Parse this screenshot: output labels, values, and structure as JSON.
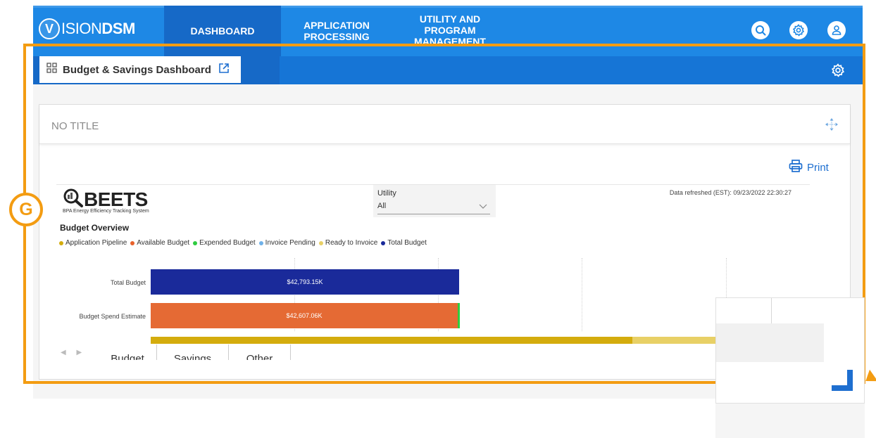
{
  "nav": {
    "logo_v": "V",
    "logo_text_a": "ISION",
    "logo_text_b": "DSM",
    "items": [
      {
        "label": "DASHBOARD"
      },
      {
        "label": "APPLICATION PROCESSING"
      },
      {
        "label": "UTILITY AND PROGRAM MANAGEMENT"
      }
    ],
    "icons": [
      "search-icon",
      "gear-icon",
      "user-icon"
    ]
  },
  "tab": {
    "title": "Budget & Savings Dashboard",
    "icons": [
      "grid-icon",
      "external-link-icon",
      "gear-icon"
    ]
  },
  "card": {
    "title": "NO TITLE",
    "print_label": "Print"
  },
  "report": {
    "logo_big": "BEETS",
    "logo_sub": "BPA Energy Efficiency Tracking System",
    "filter_label": "Utility",
    "filter_value": "All",
    "refreshed": "Data refreshed (EST): 09/23/2022 22:30:27",
    "overview_title": "Budget Overview",
    "legend": [
      {
        "name": "Application Pipeline",
        "color": "#d4ac0d"
      },
      {
        "name": "Available Budget",
        "color": "#e8622c"
      },
      {
        "name": "Expended Budget",
        "color": "#2ecc40"
      },
      {
        "name": "Invoice Pending",
        "color": "#6fb1e8"
      },
      {
        "name": "Ready to Invoice",
        "color": "#e8d066"
      },
      {
        "name": "Total Budget",
        "color": "#1a2a9a"
      }
    ],
    "rows": [
      {
        "label": "Total Budget",
        "value_label": "$42,793.15K",
        "color": "#1a2a9a"
      },
      {
        "label": "Budget Spend Estimate",
        "value_label": "$42,607.06K",
        "color": "#e56a34"
      }
    ],
    "tabs": [
      "Budget",
      "Savings",
      "Other"
    ]
  },
  "annotation": {
    "label": "G",
    "color": "#f39c12"
  }
}
